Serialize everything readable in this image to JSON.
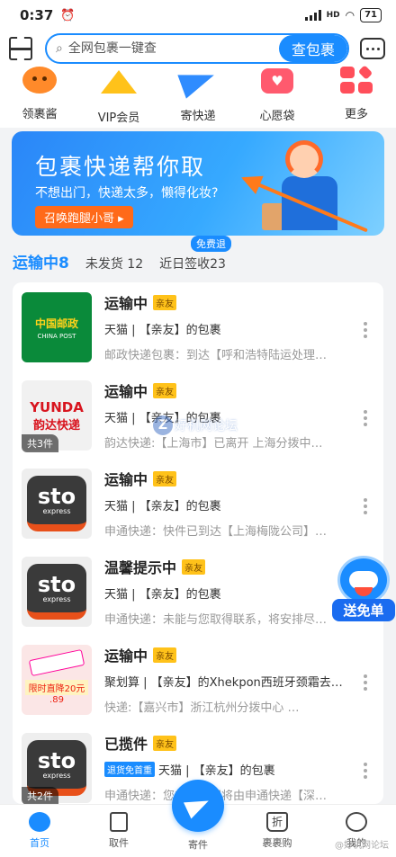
{
  "status_bar": {
    "time": "0:37",
    "battery": "71",
    "network": "HD"
  },
  "search": {
    "placeholder": "全网包裹一键查",
    "button": "查包裹"
  },
  "quick_nav": [
    {
      "label": "领裹酱",
      "icon": "mascot-icon"
    },
    {
      "label": "VIP会员",
      "icon": "crown-icon"
    },
    {
      "label": "寄快递",
      "icon": "paper-plane-icon"
    },
    {
      "label": "心愿袋",
      "icon": "heart-bag-icon"
    },
    {
      "label": "更多",
      "icon": "more-grid-icon"
    }
  ],
  "banner": {
    "title": "包裹快递帮你取",
    "subtitle": "不想出门，快递太多，懒得化妆?",
    "button": "召唤跑腿小哥 ▸"
  },
  "tabs": {
    "free_tag": "免费退",
    "items": [
      {
        "label": "运输中",
        "count": "8",
        "active": true
      },
      {
        "label": "未发货",
        "count": "12",
        "active": false
      },
      {
        "label": "近日签收",
        "count": "23",
        "active": false
      }
    ]
  },
  "packages": [
    {
      "logo": "china-post",
      "logo_text": [
        "中国邮政",
        "CHINA POST"
      ],
      "status": "运输中",
      "relation": "亲友",
      "source": "天猫 | 【亲友】的包裹",
      "detail": "邮政快递包裹：到达【呼和浩特陆运处理…",
      "count": ""
    },
    {
      "logo": "yunda",
      "logo_text": [
        "YUNDA",
        "韵达快递"
      ],
      "status": "运输中",
      "relation": "亲友",
      "source": "天猫 | 【亲友】的包裹",
      "detail": "韵达快递:【上海市】已离开 上海分拨中…",
      "count": "共3件"
    },
    {
      "logo": "sto",
      "logo_text": [
        "sto",
        "express"
      ],
      "status": "运输中",
      "relation": "亲友",
      "source": "天猫 | 【亲友】的包裹",
      "detail": "申通快递：快件已到达【上海梅陇公司】…",
      "count": ""
    },
    {
      "logo": "sto",
      "logo_text": [
        "sto",
        "express"
      ],
      "status": "温馨提示中",
      "relation": "亲友",
      "source": "天猫 | 【亲友】的包裹",
      "detail": "申通快递：未能与您取得联系，将安排尽…",
      "count": ""
    },
    {
      "logo": "product",
      "logo_text": [
        "限时直降20元",
        ".89"
      ],
      "status": "运输中",
      "relation": "亲友",
      "source": "聚划算 | 【亲友】的Xhekpon西班牙颈霜去…",
      "detail": "快递:【嘉兴市】浙江杭州分拨中心 …",
      "count": ""
    },
    {
      "logo": "sto",
      "logo_text": [
        "sto",
        "express"
      ],
      "status": "已揽件",
      "relation": "亲友",
      "source_tag": "退货免首重",
      "source": "天猫 | 【亲友】的包裹",
      "detail": "申通快递：您的宝贝即将由申通快递【深…",
      "count": "共2件"
    }
  ],
  "float_badge": {
    "label": "送免单"
  },
  "watermark": {
    "text": "好机网论坛"
  },
  "bottom_nav": [
    {
      "label": "首页",
      "active": true
    },
    {
      "label": "取件",
      "active": false
    },
    {
      "label": "寄件",
      "active": false
    },
    {
      "label": "裹裹购",
      "active": false
    },
    {
      "label": "我的",
      "active": false
    }
  ],
  "credit": "@好机网论坛",
  "colors": {
    "accent": "#1a8cff",
    "orange": "#ff7a1a",
    "tag_yellow": "#ffc21a"
  }
}
